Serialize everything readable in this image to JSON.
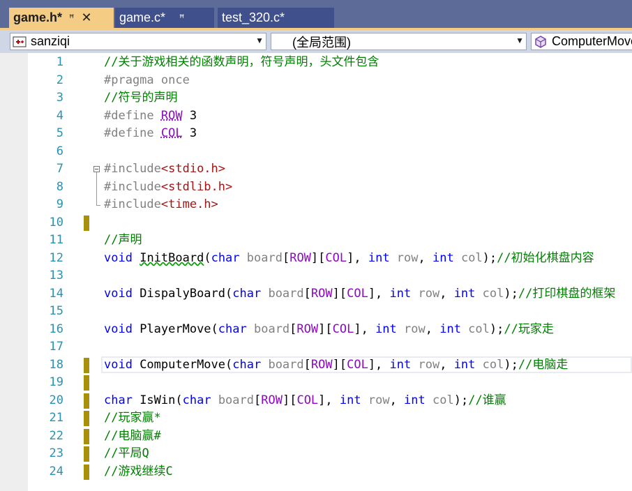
{
  "tabs": [
    {
      "label": "game.h*",
      "active": true,
      "pin": "ꟸ",
      "close": "✕"
    },
    {
      "label": "game.c*",
      "active": false,
      "pin": "ꟸ"
    },
    {
      "label": "test_320.c*",
      "active": false
    }
  ],
  "nav": {
    "project": "sanziqi",
    "scope": "(全局范围)",
    "member": "ComputerMove"
  },
  "colors": {
    "tabbar_bg": "#5d6b99",
    "active_tab": "#f5cc84",
    "comment": "#008000",
    "keyword": "#0000ff",
    "macro": "#8f08c4",
    "string": "#a31515",
    "line_number": "#2b91af",
    "change_marker": "#a8900b"
  },
  "editor": {
    "lines": [
      {
        "num": "1",
        "changed": false,
        "tokens": [
          {
            "t": "//关于游戏相关的函数声明，符号声明，头文件包含",
            "c": "cm"
          }
        ]
      },
      {
        "num": "2",
        "changed": false,
        "tokens": [
          {
            "t": "#pragma once",
            "c": "pp"
          }
        ]
      },
      {
        "num": "3",
        "changed": false,
        "tokens": [
          {
            "t": "//符号的声明",
            "c": "cm"
          }
        ]
      },
      {
        "num": "4",
        "changed": false,
        "tokens": [
          {
            "t": "#define ",
            "c": "pp"
          },
          {
            "t": "ROW",
            "c": "mac dots"
          },
          {
            "t": " 3",
            "c": "num"
          }
        ]
      },
      {
        "num": "5",
        "changed": false,
        "tokens": [
          {
            "t": "#define ",
            "c": "pp"
          },
          {
            "t": "COL",
            "c": "mac dots"
          },
          {
            "t": " 3",
            "c": "num"
          }
        ]
      },
      {
        "num": "6",
        "changed": false,
        "tokens": []
      },
      {
        "num": "7",
        "changed": false,
        "fold": "start",
        "tokens": [
          {
            "t": "#include",
            "c": "pp"
          },
          {
            "t": "<stdio.h>",
            "c": "str"
          }
        ]
      },
      {
        "num": "8",
        "changed": false,
        "fold": "mid",
        "tokens": [
          {
            "t": "#include",
            "c": "pp"
          },
          {
            "t": "<stdlib.h>",
            "c": "str"
          }
        ]
      },
      {
        "num": "9",
        "changed": false,
        "fold": "end",
        "tokens": [
          {
            "t": "#include",
            "c": "pp"
          },
          {
            "t": "<time.h>",
            "c": "str"
          }
        ]
      },
      {
        "num": "10",
        "changed": true,
        "tokens": []
      },
      {
        "num": "11",
        "changed": false,
        "tokens": [
          {
            "t": "//声明",
            "c": "cm"
          }
        ]
      },
      {
        "num": "12",
        "changed": false,
        "tokens": [
          {
            "t": "void",
            "c": "kw"
          },
          {
            "t": " ",
            "c": ""
          },
          {
            "t": "InitBoard",
            "c": "fn squig"
          },
          {
            "t": "(",
            "c": ""
          },
          {
            "t": "char",
            "c": "kw"
          },
          {
            "t": " board",
            "c": "prm"
          },
          {
            "t": "[",
            "c": ""
          },
          {
            "t": "ROW",
            "c": "mac"
          },
          {
            "t": "][",
            "c": ""
          },
          {
            "t": "COL",
            "c": "mac"
          },
          {
            "t": "], ",
            "c": ""
          },
          {
            "t": "int",
            "c": "kw"
          },
          {
            "t": " row",
            "c": "prm"
          },
          {
            "t": ", ",
            "c": ""
          },
          {
            "t": "int",
            "c": "kw"
          },
          {
            "t": " col",
            "c": "prm"
          },
          {
            "t": ");",
            "c": ""
          },
          {
            "t": "//初始化棋盘内容",
            "c": "cm"
          }
        ]
      },
      {
        "num": "13",
        "changed": false,
        "tokens": []
      },
      {
        "num": "14",
        "changed": false,
        "tokens": [
          {
            "t": "void",
            "c": "kw"
          },
          {
            "t": " DispalyBoard",
            "c": "fn"
          },
          {
            "t": "(",
            "c": ""
          },
          {
            "t": "char",
            "c": "kw"
          },
          {
            "t": " board",
            "c": "prm"
          },
          {
            "t": "[",
            "c": ""
          },
          {
            "t": "ROW",
            "c": "mac"
          },
          {
            "t": "][",
            "c": ""
          },
          {
            "t": "COL",
            "c": "mac"
          },
          {
            "t": "], ",
            "c": ""
          },
          {
            "t": "int",
            "c": "kw"
          },
          {
            "t": " row",
            "c": "prm"
          },
          {
            "t": ", ",
            "c": ""
          },
          {
            "t": "int",
            "c": "kw"
          },
          {
            "t": " col",
            "c": "prm"
          },
          {
            "t": ");",
            "c": ""
          },
          {
            "t": "//打印棋盘的框架",
            "c": "cm"
          }
        ]
      },
      {
        "num": "15",
        "changed": false,
        "tokens": []
      },
      {
        "num": "16",
        "changed": false,
        "tokens": [
          {
            "t": "void",
            "c": "kw"
          },
          {
            "t": " PlayerMove",
            "c": "fn"
          },
          {
            "t": "(",
            "c": ""
          },
          {
            "t": "char",
            "c": "kw"
          },
          {
            "t": " board",
            "c": "prm"
          },
          {
            "t": "[",
            "c": ""
          },
          {
            "t": "ROW",
            "c": "mac"
          },
          {
            "t": "][",
            "c": ""
          },
          {
            "t": "COL",
            "c": "mac"
          },
          {
            "t": "], ",
            "c": ""
          },
          {
            "t": "int",
            "c": "kw"
          },
          {
            "t": " row",
            "c": "prm"
          },
          {
            "t": ", ",
            "c": ""
          },
          {
            "t": "int",
            "c": "kw"
          },
          {
            "t": " col",
            "c": "prm"
          },
          {
            "t": ");",
            "c": ""
          },
          {
            "t": "//玩家走",
            "c": "cm"
          }
        ]
      },
      {
        "num": "17",
        "changed": false,
        "tokens": []
      },
      {
        "num": "18",
        "changed": true,
        "current": true,
        "tokens": [
          {
            "t": "void",
            "c": "kw"
          },
          {
            "t": " ComputerMove",
            "c": "fn"
          },
          {
            "t": "(",
            "c": ""
          },
          {
            "t": "char",
            "c": "kw"
          },
          {
            "t": " board",
            "c": "prm"
          },
          {
            "t": "[",
            "c": ""
          },
          {
            "t": "ROW",
            "c": "mac"
          },
          {
            "t": "][",
            "c": ""
          },
          {
            "t": "COL",
            "c": "mac"
          },
          {
            "t": "], ",
            "c": ""
          },
          {
            "t": "int",
            "c": "kw"
          },
          {
            "t": " row",
            "c": "prm"
          },
          {
            "t": ", ",
            "c": ""
          },
          {
            "t": "int",
            "c": "kw"
          },
          {
            "t": " col",
            "c": "prm"
          },
          {
            "t": ");",
            "c": ""
          },
          {
            "t": "//电脑走",
            "c": "cm"
          }
        ]
      },
      {
        "num": "19",
        "changed": true,
        "tokens": []
      },
      {
        "num": "20",
        "changed": true,
        "tokens": [
          {
            "t": "char",
            "c": "kw"
          },
          {
            "t": " IsWin",
            "c": "fn"
          },
          {
            "t": "(",
            "c": ""
          },
          {
            "t": "char",
            "c": "kw"
          },
          {
            "t": " board",
            "c": "prm"
          },
          {
            "t": "[",
            "c": ""
          },
          {
            "t": "ROW",
            "c": "mac"
          },
          {
            "t": "][",
            "c": ""
          },
          {
            "t": "COL",
            "c": "mac"
          },
          {
            "t": "], ",
            "c": ""
          },
          {
            "t": "int",
            "c": "kw"
          },
          {
            "t": " row",
            "c": "prm"
          },
          {
            "t": ", ",
            "c": ""
          },
          {
            "t": "int",
            "c": "kw"
          },
          {
            "t": " col",
            "c": "prm"
          },
          {
            "t": ");",
            "c": ""
          },
          {
            "t": "//谁赢",
            "c": "cm"
          }
        ]
      },
      {
        "num": "21",
        "changed": true,
        "tokens": [
          {
            "t": "//玩家赢*",
            "c": "cm"
          }
        ]
      },
      {
        "num": "22",
        "changed": true,
        "tokens": [
          {
            "t": "//电脑赢#",
            "c": "cm"
          }
        ]
      },
      {
        "num": "23",
        "changed": true,
        "tokens": [
          {
            "t": "//平局Q",
            "c": "cm"
          }
        ]
      },
      {
        "num": "24",
        "changed": true,
        "tokens": [
          {
            "t": "//游戏继续C",
            "c": "cm"
          }
        ]
      }
    ]
  }
}
